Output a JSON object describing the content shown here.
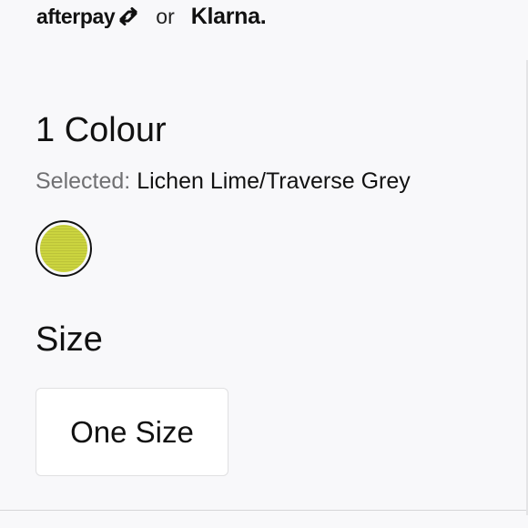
{
  "payments": {
    "afterpay_label": "afterpay",
    "or_label": "or",
    "klarna_label": "Klarna.",
    "afterpay_icon": "afterpay-arrows-icon"
  },
  "colour": {
    "heading": "1 Colour",
    "selected_label": "Selected:",
    "selected_value": "Lichen Lime/Traverse Grey",
    "swatches": [
      {
        "name": "Lichen Lime/Traverse Grey",
        "color": "#cbd43f",
        "selected": true
      }
    ]
  },
  "size": {
    "heading": "Size",
    "options": [
      {
        "label": "One Size"
      }
    ]
  }
}
